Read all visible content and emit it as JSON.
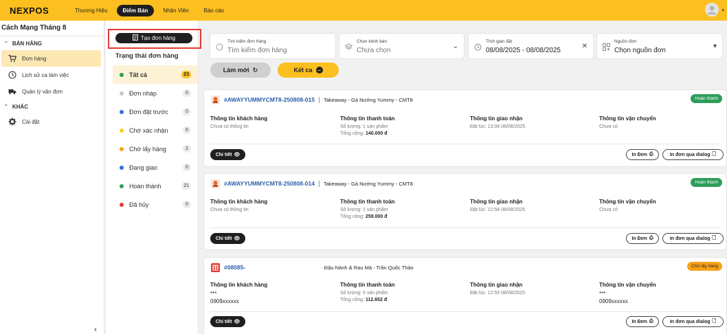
{
  "app": {
    "logo": "NEXPOS"
  },
  "topnav": {
    "items": [
      {
        "label": "Thương Hiệu"
      },
      {
        "label": "Điểm Bán"
      },
      {
        "label": "Nhân Viên"
      },
      {
        "label": "Báo cáo"
      }
    ]
  },
  "sidebar": {
    "shop_name": "Cách Mạng Tháng 8",
    "group_sales": "BÁN HÀNG",
    "items_sales": [
      {
        "label": "Đơn hàng",
        "icon": "cart-icon"
      },
      {
        "label": "Lịch sử ca làm việc",
        "icon": "clock-icon"
      },
      {
        "label": "Quản lý vận đơn",
        "icon": "truck-icon"
      }
    ],
    "group_other": "KHÁC",
    "items_other": [
      {
        "label": "Cài đặt",
        "icon": "gear-icon"
      }
    ],
    "collapse_label": "‹"
  },
  "status_panel": {
    "create_label": "Tạo đơn hàng",
    "title": "Trạng thái đơn hàng",
    "items": [
      {
        "label": "Tất cả",
        "count": "23",
        "color": "#2e9d5b"
      },
      {
        "label": "Đơn nháp",
        "count": "0",
        "color": "#c8c8c8"
      },
      {
        "label": "Đơn đặt trước",
        "count": "0",
        "color": "#2f6fe0"
      },
      {
        "label": "Chờ xác nhận",
        "count": "0",
        "color": "#f5d21c"
      },
      {
        "label": "Chờ lấy hàng",
        "count": "2",
        "color": "#f6a21a"
      },
      {
        "label": "Đang giao",
        "count": "0",
        "color": "#2f6fe0"
      },
      {
        "label": "Hoàn thành",
        "count": "21",
        "color": "#2e9d5b"
      },
      {
        "label": "Đã hủy",
        "count": "0",
        "color": "#e53935"
      }
    ]
  },
  "filters": {
    "search_label": "Tìm kiếm đơn hàng",
    "search_placeholder": "Tìm kiếm đơn hàng",
    "channel_label": "Chọn kênh bán",
    "channel_value": "Chưa chọn",
    "time_label": "Thời gian đặt",
    "time_value": "08/08/2025 - 08/08/2025",
    "source_label": "Nguồn đơn",
    "source_value": "Chọn nguồn đơn"
  },
  "actions": {
    "refresh": "Làm mới",
    "end_shift": "Kết ca"
  },
  "labels": {
    "customer": "Thông tin khách hàng",
    "payment": "Thông tin thanh toán",
    "delivery": "Thông tin giao nhận",
    "shipping": "Thông tin vận chuyển",
    "detail": "Chi tiết",
    "print": "In Đơn",
    "print_dialog": "In đơn qua dialog"
  },
  "orders": [
    {
      "code": "#AWAYYUMMYCMT8-250808-015",
      "channel": "Takeaway - Gà Nướng Yummy - CMT8",
      "status": "Hoàn thành",
      "customer_line1": "Chưa có thông tin",
      "customer_line2": "",
      "qty_label": "Số lượng:",
      "qty_value": "1 sản phẩm",
      "total_label": "Tổng cộng:",
      "total_value": "140.000 đ",
      "ordered_at_label": "Đặt lúc:",
      "ordered_at": "13:08 08/08/2025",
      "shipping_line1": "Chưa có",
      "shipping_line2": ""
    },
    {
      "code": "#AWAYYUMMYCMT8-250808-014",
      "channel": "Takeaway - Gà Nướng Yummy - CMT8",
      "status": "Hoàn thành",
      "customer_line1": "Chưa có thông tin",
      "customer_line2": "",
      "qty_label": "Số lượng:",
      "qty_value": "1 sản phẩm",
      "total_label": "Tổng cộng:",
      "total_value": "259.000 đ",
      "ordered_at_label": "Đặt lúc:",
      "ordered_at": "12:58 08/08/2025",
      "shipping_line1": "Chưa có",
      "shipping_line2": ""
    },
    {
      "code": "#08085-",
      "channel": "Đậu Nành & Rau Má - Trần Quốc Thảo",
      "status": "Chờ lấy hàng",
      "customer_line1": "***",
      "customer_line2": "0909xxxxxx",
      "qty_label": "Số lượng:",
      "qty_value": "5 sản phẩm",
      "total_label": "Tổng cộng:",
      "total_value": "112.652 đ",
      "ordered_at_label": "Đặt lúc:",
      "ordered_at": "12:55 08/08/2025",
      "shipping_line1": "***",
      "shipping_line2": "0909xxxxxx"
    }
  ],
  "colors": {
    "accent": "#fbbf1f",
    "dark": "#1f1f1f",
    "link": "#2b5fa8",
    "done": "#2e9d5b",
    "pending": "#f6a21a",
    "highlight": "#e53935"
  }
}
